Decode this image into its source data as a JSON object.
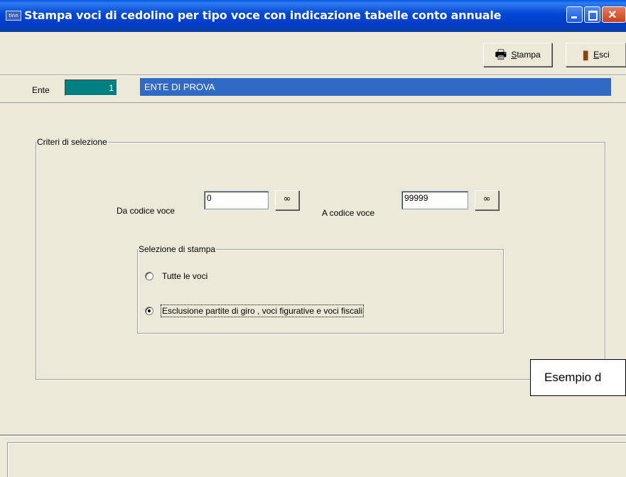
{
  "window": {
    "app_icon_text": "tinn",
    "title": "Stampa voci di cedolino per tipo voce con indicazione tabelle conto annuale"
  },
  "toolbar": {
    "stampa_label": "Stampa",
    "esci_label": "Esci"
  },
  "ente": {
    "label": "Ente",
    "code": "1",
    "name": "ENTE DI PROVA"
  },
  "criteri": {
    "legend": "Criteri di selezione",
    "da_label": "Da codice voce",
    "da_value": "0",
    "a_label": "A codice voce",
    "a_value": "99999",
    "glasses_icon": "∞"
  },
  "selezione": {
    "legend": "Selezione di stampa",
    "options": [
      {
        "label": "Tutte le voci",
        "selected": false
      },
      {
        "label": "Esclusione partite di giro , voci figurative e voci fiscali",
        "selected": true
      }
    ]
  },
  "overlay": {
    "text": "Esempio d"
  }
}
